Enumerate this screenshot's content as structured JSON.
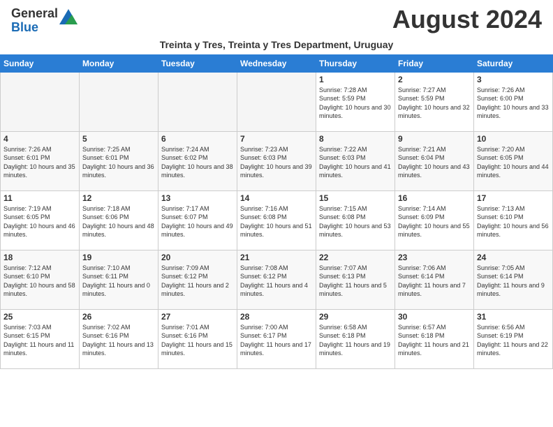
{
  "header": {
    "logo_general": "General",
    "logo_blue": "Blue",
    "month_title": "August 2024",
    "subtitle": "Treinta y Tres, Treinta y Tres Department, Uruguay"
  },
  "days_of_week": [
    "Sunday",
    "Monday",
    "Tuesday",
    "Wednesday",
    "Thursday",
    "Friday",
    "Saturday"
  ],
  "weeks": [
    [
      {
        "day": "",
        "empty": true
      },
      {
        "day": "",
        "empty": true
      },
      {
        "day": "",
        "empty": true
      },
      {
        "day": "",
        "empty": true
      },
      {
        "day": "1",
        "sunrise": "7:28 AM",
        "sunset": "5:59 PM",
        "daylight": "10 hours and 30 minutes."
      },
      {
        "day": "2",
        "sunrise": "7:27 AM",
        "sunset": "5:59 PM",
        "daylight": "10 hours and 32 minutes."
      },
      {
        "day": "3",
        "sunrise": "7:26 AM",
        "sunset": "6:00 PM",
        "daylight": "10 hours and 33 minutes."
      }
    ],
    [
      {
        "day": "4",
        "sunrise": "7:26 AM",
        "sunset": "6:01 PM",
        "daylight": "10 hours and 35 minutes."
      },
      {
        "day": "5",
        "sunrise": "7:25 AM",
        "sunset": "6:01 PM",
        "daylight": "10 hours and 36 minutes."
      },
      {
        "day": "6",
        "sunrise": "7:24 AM",
        "sunset": "6:02 PM",
        "daylight": "10 hours and 38 minutes."
      },
      {
        "day": "7",
        "sunrise": "7:23 AM",
        "sunset": "6:03 PM",
        "daylight": "10 hours and 39 minutes."
      },
      {
        "day": "8",
        "sunrise": "7:22 AM",
        "sunset": "6:03 PM",
        "daylight": "10 hours and 41 minutes."
      },
      {
        "day": "9",
        "sunrise": "7:21 AM",
        "sunset": "6:04 PM",
        "daylight": "10 hours and 43 minutes."
      },
      {
        "day": "10",
        "sunrise": "7:20 AM",
        "sunset": "6:05 PM",
        "daylight": "10 hours and 44 minutes."
      }
    ],
    [
      {
        "day": "11",
        "sunrise": "7:19 AM",
        "sunset": "6:05 PM",
        "daylight": "10 hours and 46 minutes."
      },
      {
        "day": "12",
        "sunrise": "7:18 AM",
        "sunset": "6:06 PM",
        "daylight": "10 hours and 48 minutes."
      },
      {
        "day": "13",
        "sunrise": "7:17 AM",
        "sunset": "6:07 PM",
        "daylight": "10 hours and 49 minutes."
      },
      {
        "day": "14",
        "sunrise": "7:16 AM",
        "sunset": "6:08 PM",
        "daylight": "10 hours and 51 minutes."
      },
      {
        "day": "15",
        "sunrise": "7:15 AM",
        "sunset": "6:08 PM",
        "daylight": "10 hours and 53 minutes."
      },
      {
        "day": "16",
        "sunrise": "7:14 AM",
        "sunset": "6:09 PM",
        "daylight": "10 hours and 55 minutes."
      },
      {
        "day": "17",
        "sunrise": "7:13 AM",
        "sunset": "6:10 PM",
        "daylight": "10 hours and 56 minutes."
      }
    ],
    [
      {
        "day": "18",
        "sunrise": "7:12 AM",
        "sunset": "6:10 PM",
        "daylight": "10 hours and 58 minutes."
      },
      {
        "day": "19",
        "sunrise": "7:10 AM",
        "sunset": "6:11 PM",
        "daylight": "11 hours and 0 minutes."
      },
      {
        "day": "20",
        "sunrise": "7:09 AM",
        "sunset": "6:12 PM",
        "daylight": "11 hours and 2 minutes."
      },
      {
        "day": "21",
        "sunrise": "7:08 AM",
        "sunset": "6:12 PM",
        "daylight": "11 hours and 4 minutes."
      },
      {
        "day": "22",
        "sunrise": "7:07 AM",
        "sunset": "6:13 PM",
        "daylight": "11 hours and 5 minutes."
      },
      {
        "day": "23",
        "sunrise": "7:06 AM",
        "sunset": "6:14 PM",
        "daylight": "11 hours and 7 minutes."
      },
      {
        "day": "24",
        "sunrise": "7:05 AM",
        "sunset": "6:14 PM",
        "daylight": "11 hours and 9 minutes."
      }
    ],
    [
      {
        "day": "25",
        "sunrise": "7:03 AM",
        "sunset": "6:15 PM",
        "daylight": "11 hours and 11 minutes."
      },
      {
        "day": "26",
        "sunrise": "7:02 AM",
        "sunset": "6:16 PM",
        "daylight": "11 hours and 13 minutes."
      },
      {
        "day": "27",
        "sunrise": "7:01 AM",
        "sunset": "6:16 PM",
        "daylight": "11 hours and 15 minutes."
      },
      {
        "day": "28",
        "sunrise": "7:00 AM",
        "sunset": "6:17 PM",
        "daylight": "11 hours and 17 minutes."
      },
      {
        "day": "29",
        "sunrise": "6:58 AM",
        "sunset": "6:18 PM",
        "daylight": "11 hours and 19 minutes."
      },
      {
        "day": "30",
        "sunrise": "6:57 AM",
        "sunset": "6:18 PM",
        "daylight": "11 hours and 21 minutes."
      },
      {
        "day": "31",
        "sunrise": "6:56 AM",
        "sunset": "6:19 PM",
        "daylight": "11 hours and 22 minutes."
      }
    ]
  ]
}
